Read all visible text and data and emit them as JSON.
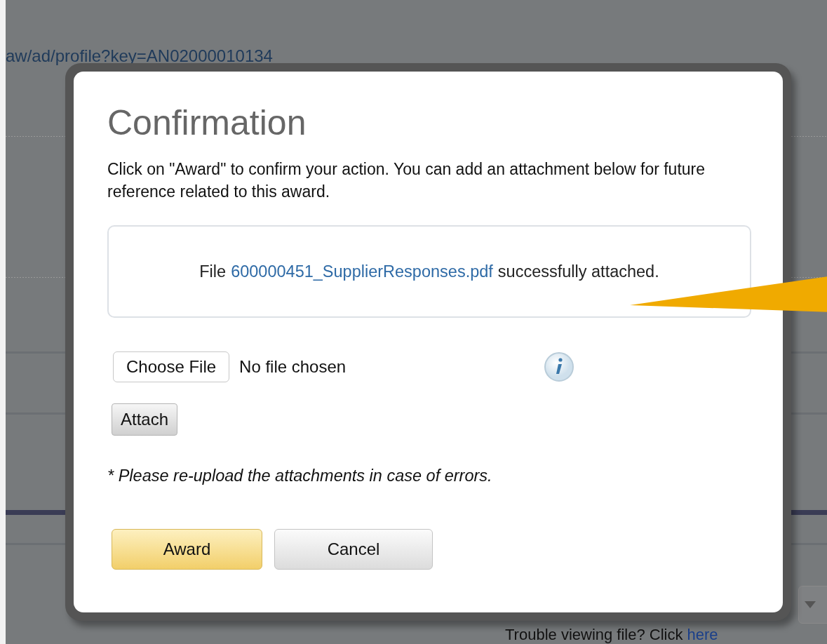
{
  "background": {
    "url_text": "aw/ad/profile?key=AN02000010134",
    "help_text": "Trouble viewing file? Click",
    "help_link": "here"
  },
  "dialog": {
    "title": "Confirmation",
    "message": "Click on \"Award\" to confirm your action. You can add an attachment below for future reference related to this award.",
    "status": {
      "prefix": "File",
      "file_link": "600000451_SupplierResponses.pdf",
      "suffix": "successfully attached."
    },
    "file_input": {
      "button": "Choose File",
      "value": "No file chosen"
    },
    "attach_button": "Attach",
    "note": "* Please re-upload the attachments in case of errors.",
    "buttons": [
      {
        "label": "Award",
        "primary": true
      },
      {
        "label": "Cancel",
        "primary": false
      }
    ]
  }
}
